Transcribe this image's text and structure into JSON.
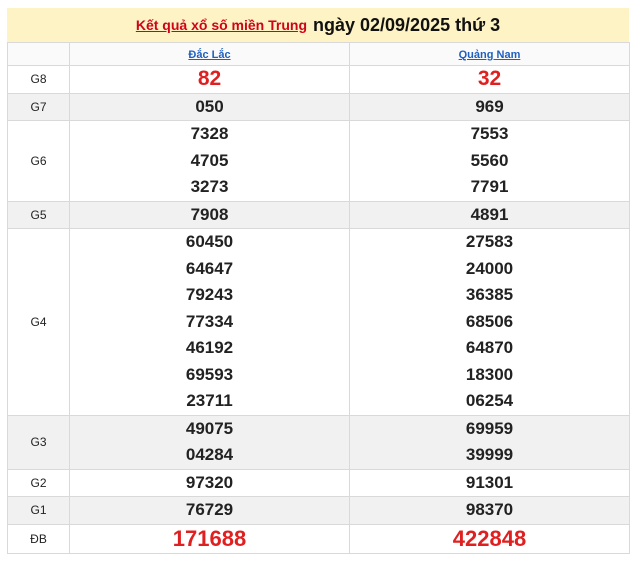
{
  "header": {
    "link_text": "Kết quả xổ số miền Trung",
    "date_text": "ngày 02/09/2025 thứ 3"
  },
  "provinces": [
    "Đắc Lắc",
    "Quảng Nam"
  ],
  "prizes": [
    {
      "label": "G8",
      "values": [
        [
          "82"
        ],
        [
          "32"
        ]
      ]
    },
    {
      "label": "G7",
      "values": [
        [
          "050"
        ],
        [
          "969"
        ]
      ]
    },
    {
      "label": "G6",
      "values": [
        [
          "7328",
          "4705",
          "3273"
        ],
        [
          "7553",
          "5560",
          "7791"
        ]
      ]
    },
    {
      "label": "G5",
      "values": [
        [
          "7908"
        ],
        [
          "4891"
        ]
      ]
    },
    {
      "label": "G4",
      "values": [
        [
          "60450",
          "64647",
          "79243",
          "77334",
          "46192",
          "69593",
          "23711"
        ],
        [
          "27583",
          "24000",
          "36385",
          "68506",
          "64870",
          "18300",
          "06254"
        ]
      ]
    },
    {
      "label": "G3",
      "values": [
        [
          "49075",
          "04284"
        ],
        [
          "69959",
          "39999"
        ]
      ]
    },
    {
      "label": "G2",
      "values": [
        [
          "97320"
        ],
        [
          "91301"
        ]
      ]
    },
    {
      "label": "G1",
      "values": [
        [
          "76729"
        ],
        [
          "98370"
        ]
      ]
    },
    {
      "label": "ĐB",
      "values": [
        [
          "171688"
        ],
        [
          "422848"
        ]
      ]
    }
  ],
  "colors": {
    "highlight": "#e02020",
    "link": "#1f5fbf",
    "title_bg": "#fdf3c4"
  }
}
